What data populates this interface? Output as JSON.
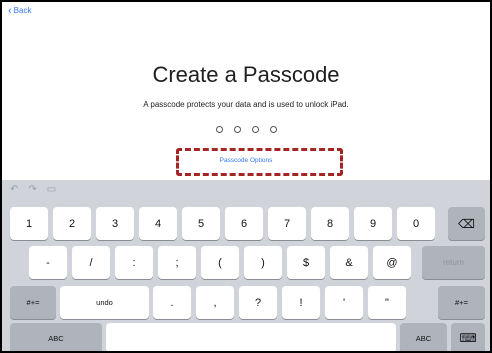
{
  "nav": {
    "back_label": "Back"
  },
  "main": {
    "title": "Create a Passcode",
    "subtitle": "A passcode protects your data and is used to unlock iPad.",
    "passcode_options_label": "Passcode Options"
  },
  "keyboard": {
    "toolbar_icons": [
      "undo-icon",
      "redo-icon",
      "paste-icon"
    ],
    "row1": [
      "1",
      "2",
      "3",
      "4",
      "5",
      "6",
      "7",
      "8",
      "9",
      "0"
    ],
    "row2": [
      "-",
      "/",
      ":",
      ";",
      "(",
      ")",
      "$",
      "&",
      "@"
    ],
    "return_label": "return",
    "row3_left": "#+=",
    "undo_label": "undo",
    "row3": [
      ".",
      ",",
      "?",
      "!",
      "'",
      "\""
    ],
    "row3_right": "#+=",
    "abc_label": "ABC",
    "delete_icon": "delete-icon",
    "keyboard_dismiss_icon": "keyboard-dismiss-icon"
  },
  "colors": {
    "accent": "#3478f6",
    "highlight": "#a52424",
    "keyboard_bg": "#d0d3d9"
  }
}
